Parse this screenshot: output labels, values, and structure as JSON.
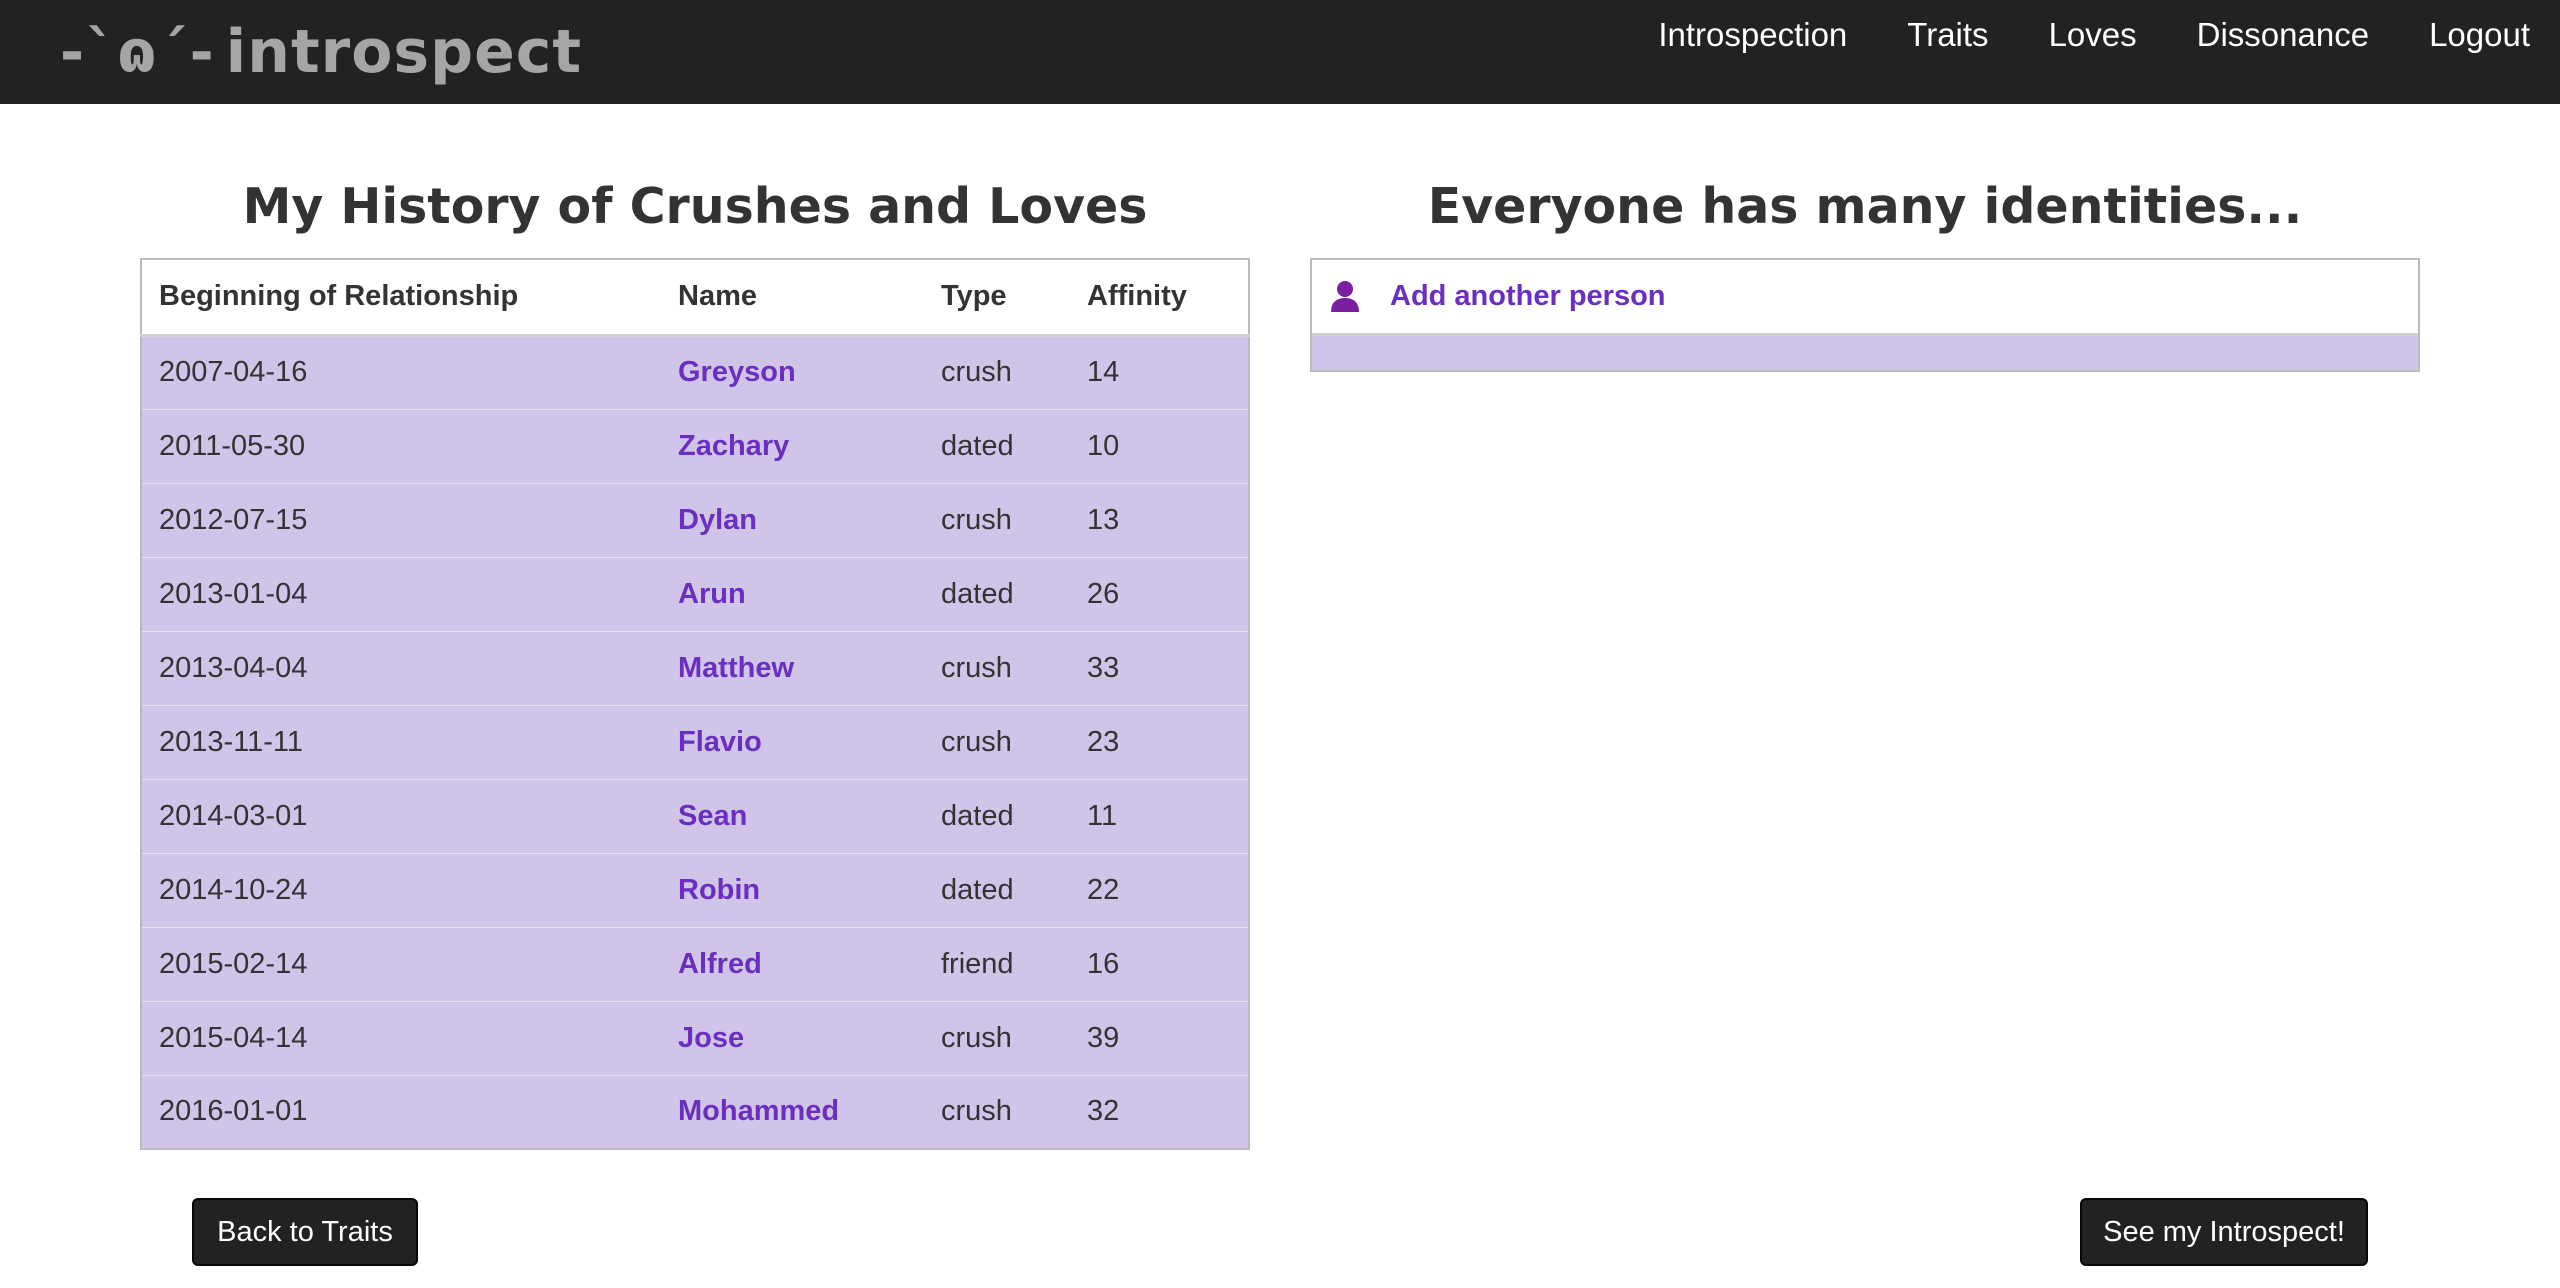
{
  "navbar": {
    "brand_mark": "-`ɷ´-",
    "brand_name": "introspect",
    "links": [
      "Introspection",
      "Traits",
      "Loves",
      "Dissonance",
      "Logout"
    ]
  },
  "loves_section": {
    "title": "My History of Crushes and Loves",
    "columns": [
      "Beginning of Relationship",
      "Name",
      "Type",
      "Affinity"
    ],
    "rows": [
      {
        "date": "2007-04-16",
        "name": "Greyson",
        "type": "crush",
        "affinity": "14"
      },
      {
        "date": "2011-05-30",
        "name": "Zachary",
        "type": "dated",
        "affinity": "10"
      },
      {
        "date": "2012-07-15",
        "name": "Dylan",
        "type": "crush",
        "affinity": "13"
      },
      {
        "date": "2013-01-04",
        "name": "Arun",
        "type": "dated",
        "affinity": "26"
      },
      {
        "date": "2013-04-04",
        "name": "Matthew",
        "type": "crush",
        "affinity": "33"
      },
      {
        "date": "2013-11-11",
        "name": "Flavio",
        "type": "crush",
        "affinity": "23"
      },
      {
        "date": "2014-03-01",
        "name": "Sean",
        "type": "dated",
        "affinity": "11"
      },
      {
        "date": "2014-10-24",
        "name": "Robin",
        "type": "dated",
        "affinity": "22"
      },
      {
        "date": "2015-02-14",
        "name": "Alfred",
        "type": "friend",
        "affinity": "16"
      },
      {
        "date": "2015-04-14",
        "name": "Jose",
        "type": "crush",
        "affinity": "39"
      },
      {
        "date": "2016-01-01",
        "name": "Mohammed",
        "type": "crush",
        "affinity": "32"
      }
    ]
  },
  "identities_section": {
    "title": "Everyone has many identities...",
    "add_label": "Add another person",
    "add_icon": "person-icon"
  },
  "buttons": {
    "back": "Back to Traits",
    "see": "See my Introspect!"
  },
  "colors": {
    "navbar_bg": "#222222",
    "row_bg": "#d1c4e9",
    "link": "#6a2fc0",
    "person_icon": "#7b1fa2"
  }
}
